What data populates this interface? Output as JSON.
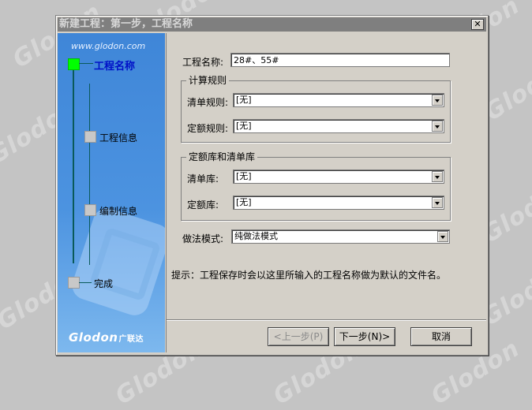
{
  "watermark": "Glodon",
  "window": {
    "title": "新建工程：第一步，工程名称",
    "close_glyph": "✕"
  },
  "sidebar": {
    "site": "www.glodon.com",
    "steps": [
      {
        "label": "工程名称",
        "active": true
      },
      {
        "label": "工程信息",
        "active": false
      },
      {
        "label": "编制信息",
        "active": false
      },
      {
        "label": "完成",
        "active": false
      }
    ],
    "brand": "Glodon",
    "brand_cn": "广联达"
  },
  "form": {
    "project_name_label": "工程名称:",
    "project_name_value": "28#、55#",
    "calc_rules": {
      "title": "计算规则",
      "bill_rule_label": "清单规则:",
      "bill_rule_value": "[无]",
      "quota_rule_label": "定额规则:",
      "quota_rule_value": "[无]"
    },
    "libraries": {
      "title": "定额库和清单库",
      "bill_lib_label": "清单库:",
      "bill_lib_value": "[无]",
      "quota_lib_label": "定额库:",
      "quota_lib_value": "[无]"
    },
    "method_label": "做法模式:",
    "method_value": "纯做法模式",
    "hint": "提示：工程保存时会以这里所输入的工程名称做为默认的文件名。"
  },
  "buttons": {
    "prev": "<上一步(P)",
    "next": "下一步(N)>",
    "cancel": "取消"
  }
}
